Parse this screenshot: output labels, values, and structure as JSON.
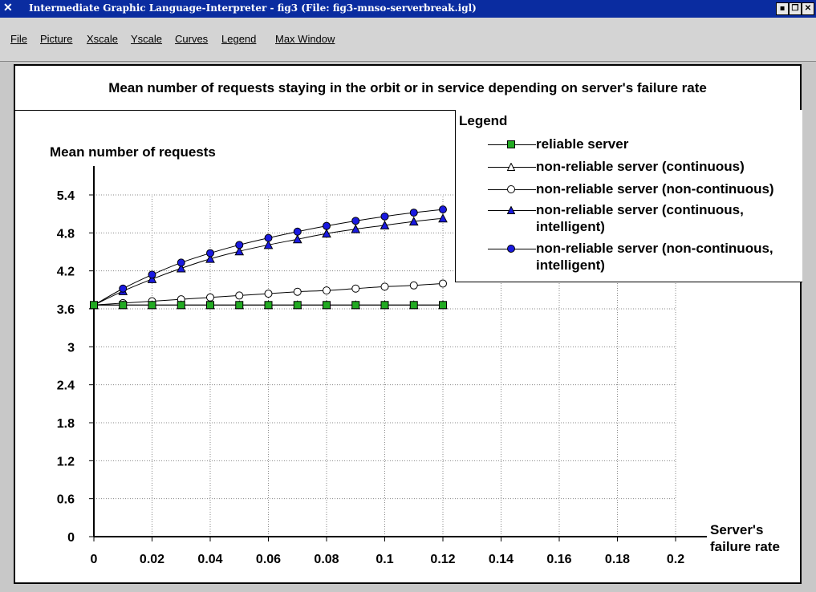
{
  "window": {
    "title": "Intermediate Graphic Language-Interpreter - fig3 (File: fig3-mnso-serverbreak.igl)",
    "icon": "x-logo-icon",
    "buttons": [
      "minimize",
      "restore",
      "close"
    ]
  },
  "menu": {
    "items": [
      "File",
      "Picture",
      "Xscale",
      "Yscale",
      "Curves",
      "Legend",
      "Max Window"
    ]
  },
  "chart_data": {
    "type": "line",
    "title": "Mean number of requests staying in the orbit or in service depending on server's failure rate",
    "ylabel": "Mean number of requests",
    "xlabel": "Server's failure rate",
    "xlim": [
      0,
      0.2
    ],
    "ylim": [
      0,
      5.4
    ],
    "xticks": [
      "0",
      "0.02",
      "0.04",
      "0.06",
      "0.08",
      "0.1",
      "0.12",
      "0.14",
      "0.16",
      "0.18",
      "0.2"
    ],
    "yticks": [
      "0",
      "0.6",
      "1.2",
      "1.8",
      "2.4",
      "3",
      "3.6",
      "4.2",
      "4.8",
      "5.4"
    ],
    "grid": true,
    "legend_title": "Legend",
    "legend_position": "top-right",
    "x": [
      0,
      0.01,
      0.02,
      0.03,
      0.04,
      0.05,
      0.06,
      0.07,
      0.08,
      0.09,
      0.1,
      0.11,
      0.12
    ],
    "series": [
      {
        "name": "reliable server",
        "marker": "square",
        "color": "#22aa22",
        "values": [
          3.66,
          3.66,
          3.66,
          3.66,
          3.66,
          3.66,
          3.66,
          3.66,
          3.66,
          3.66,
          3.66,
          3.66,
          3.66
        ]
      },
      {
        "name": "non-reliable server (continuous)",
        "marker": "triangle-open",
        "color": "#ffffff",
        "values": [
          3.66,
          3.66,
          3.66,
          3.66,
          3.66,
          3.66,
          3.66,
          3.66,
          3.66,
          3.66,
          3.66,
          3.66,
          3.66
        ]
      },
      {
        "name": "non-reliable server (non-continuous)",
        "marker": "circle-open",
        "color": "#ffffff",
        "values": [
          3.66,
          3.69,
          3.72,
          3.75,
          3.78,
          3.81,
          3.84,
          3.87,
          3.89,
          3.92,
          3.95,
          3.97,
          4.0
        ]
      },
      {
        "name": "non-reliable server (continuous,\nintelligent)",
        "marker": "triangle-filled",
        "color": "#1a1ae0",
        "values": [
          3.66,
          3.88,
          4.07,
          4.24,
          4.39,
          4.51,
          4.61,
          4.7,
          4.79,
          4.86,
          4.92,
          4.98,
          5.03
        ]
      },
      {
        "name": "non-reliable server (non-continuous,\nintelligent)",
        "marker": "circle-filled",
        "color": "#1a1ae0",
        "values": [
          3.66,
          3.92,
          4.14,
          4.33,
          4.48,
          4.61,
          4.72,
          4.82,
          4.91,
          4.99,
          5.06,
          5.12,
          5.17
        ]
      }
    ]
  }
}
